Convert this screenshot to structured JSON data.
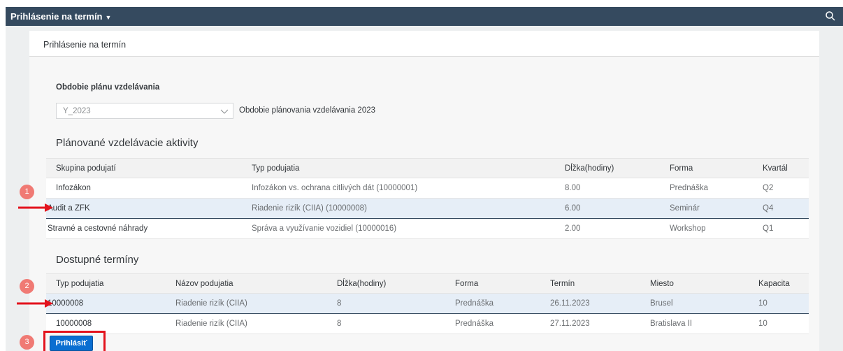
{
  "shellbar": {
    "title": "Prihlásenie na termín",
    "caret": "▼",
    "search_icon": "search-icon"
  },
  "page": {
    "header_title": "Prihlásenie na termín"
  },
  "period": {
    "label": "Obdobie plánu vzdelávania",
    "selected_value": "Y_2023",
    "description": "Obdobie plánovania vzdelávania 2023"
  },
  "planned": {
    "title": "Plánované vzdelávacie aktivity",
    "headers": [
      "Skupina podujatí",
      "Typ podujatia",
      "Dĺžka(hodiny)",
      "Forma",
      "Kvartál"
    ],
    "rows": [
      [
        "Infozákon",
        "Infozákon vs. ochrana citlivých dát (10000001)",
        "8.00",
        "Prednáška",
        "Q2"
      ],
      [
        "Audit a ZFK",
        "Riadenie rizík (CIIA) (10000008)",
        "6.00",
        "Seminár",
        "Q4"
      ],
      [
        "Stravné a cestovné náhrady",
        "Správa a využívanie vozidiel (10000016)",
        "2.00",
        "Workshop",
        "Q1"
      ]
    ],
    "selected_row": 1
  },
  "available": {
    "title": "Dostupné termíny",
    "headers": [
      "Typ podujatia",
      "Názov podujatia",
      "Dĺžka(hodiny)",
      "Forma",
      "Termín",
      "Miesto",
      "Kapacita"
    ],
    "rows": [
      [
        "10000008",
        "Riadenie rizík (CIIA)",
        "8",
        "Prednáška",
        "26.11.2023",
        "Brusel",
        "10"
      ],
      [
        "10000008",
        "Riadenie rizík (CIIA)",
        "8",
        "Prednáška",
        "27.11.2023",
        "Bratislava II",
        "10"
      ]
    ],
    "selected_row": 0
  },
  "actions": {
    "submit_label": "Prihlásiť"
  },
  "annotations": {
    "badges": [
      "1",
      "2",
      "3"
    ],
    "accent": "#e3131d",
    "badge_color": "#f07a74"
  },
  "colors": {
    "shellbar": "#354a5f",
    "button": "#0a6ed1",
    "selected_row": "#e6eef7"
  }
}
